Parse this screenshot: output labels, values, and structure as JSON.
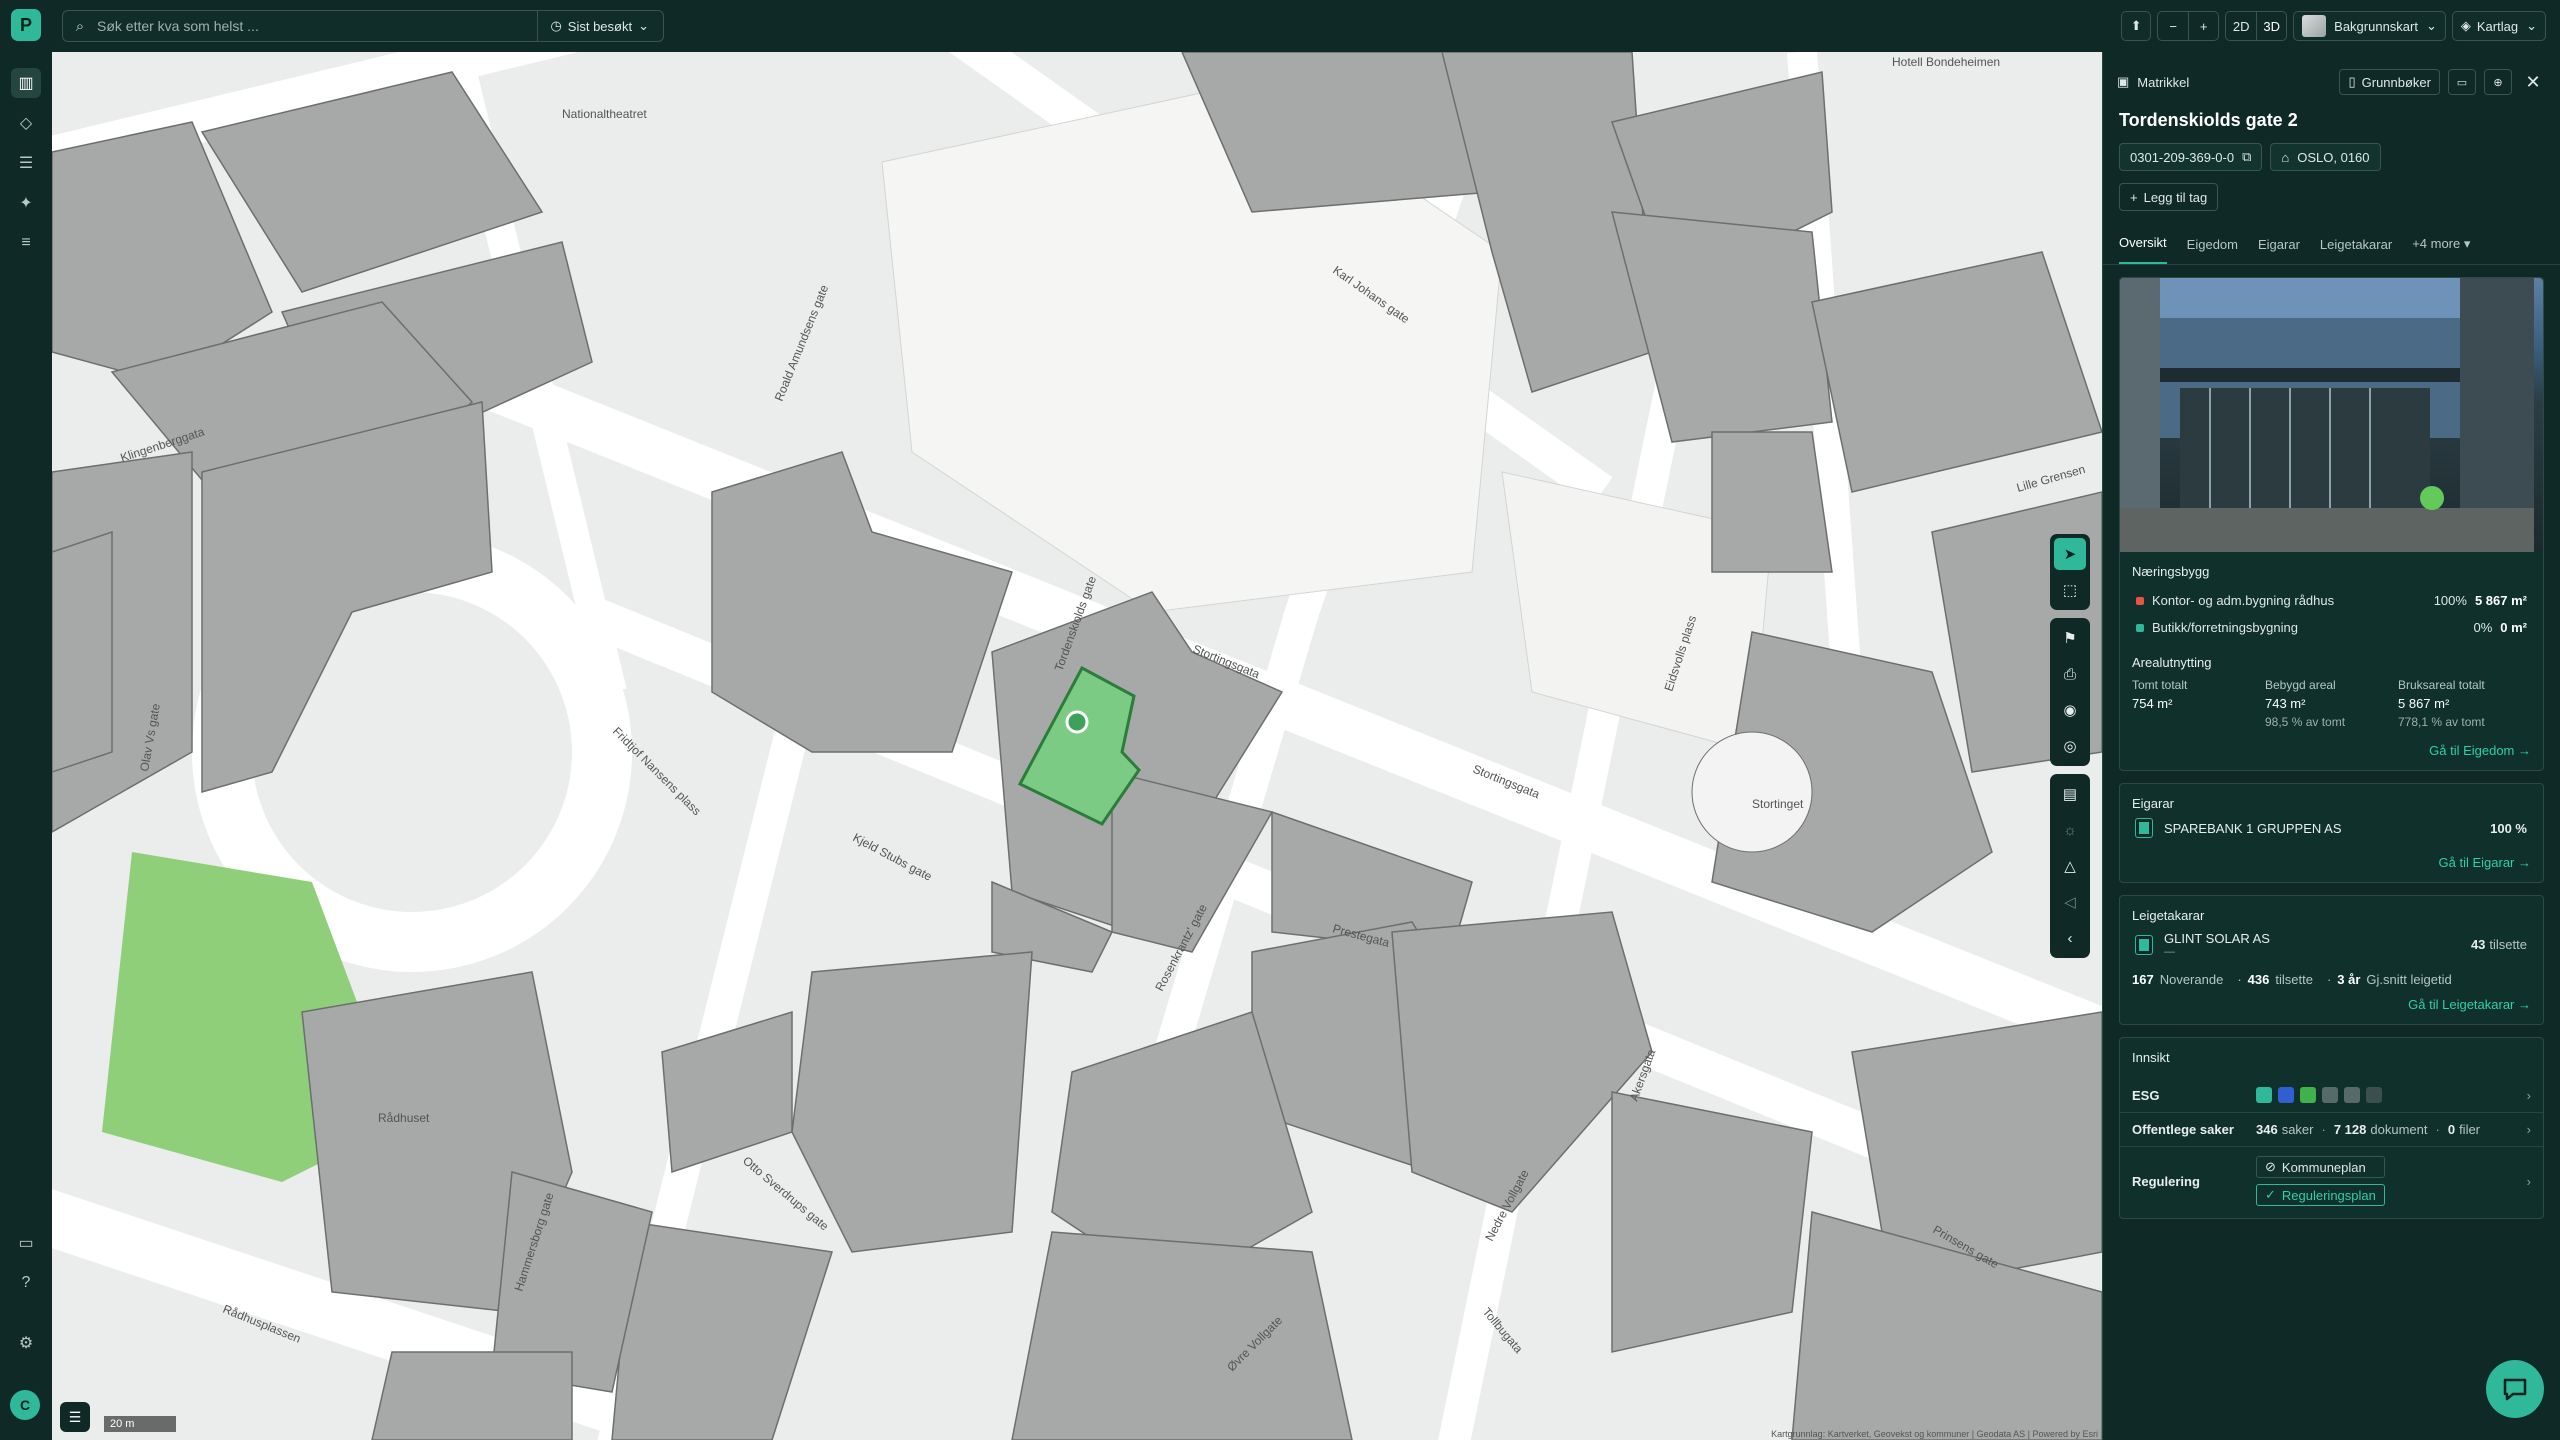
{
  "search": {
    "placeholder": "Søk etter kva som helst ...",
    "recent_label": "Sist besøkt"
  },
  "toolbar": {
    "zoom_out": "−",
    "zoom_in": "+",
    "view_2d": "2D",
    "view_3d": "3D",
    "background_label": "Bakgrunnskart",
    "layers_label": "Kartlag"
  },
  "map": {
    "scale_label": "20 m",
    "attribution": "Kartgrunnlag: Kartverket, Geovekst og kommuner | Geodata AS | Powered by Esri",
    "streets": [
      "Stortingsgata",
      "Karl Johans gate",
      "Roald Amundsens gate",
      "Tordenskiolds gate",
      "Kjeld Stubs gate",
      "Rosenkrantz' gate",
      "Fridtjof Nansens plass",
      "Klingenberggata",
      "Olav Vs gate",
      "Prestegata",
      "Akersgata",
      "Nedre Vollgate",
      "Tollbugata",
      "Rådhusplassen",
      "Hammersborg gate",
      "Otto Sverdrups gate",
      "Øvre Vollgate",
      "Lille Grensen",
      "Eidsvolls plass",
      "Prinsens gate"
    ],
    "places": [
      "Nationaltheatret",
      "Rådhuset",
      "Stortinget",
      "Hotell Bondeheimen"
    ]
  },
  "panel": {
    "breadcrumb": "Matrikkel",
    "grunnboker_label": "Grunnbøker",
    "title": "Tordenskiolds gate 2",
    "matrikkel_id": "0301-209-369-0-0",
    "location": "OSLO, 0160",
    "add_tag": "Legg til tag",
    "tabs": [
      "Oversikt",
      "Eigedom",
      "Eigarar",
      "Leigetakarar",
      "+4 more"
    ],
    "building_type": "Næringsbygg",
    "uses": [
      {
        "name": "Kontor- og adm.bygning rådhus",
        "pct": "100%",
        "area": "5 867 m²",
        "color": "#e8543f"
      },
      {
        "name": "Butikk/forretningsbygning",
        "pct": "0%",
        "area": "0 m²",
        "color": "#2fb89a"
      }
    ],
    "area_title": "Arealutnytting",
    "area_stats": [
      {
        "label": "Tomt totalt",
        "value": "754 m²",
        "sub": ""
      },
      {
        "label": "Bebygd areal",
        "value": "743 m²",
        "sub": "98,5 % av tomt"
      },
      {
        "label": "Bruksareal totalt",
        "value": "5 867 m²",
        "sub": "778,1 % av tomt"
      }
    ],
    "to_property": "Gå til Eigedom →",
    "owners_title": "Eigarar",
    "owner_name": "SPAREBANK 1 GRUPPEN AS",
    "owner_pct": "100 %",
    "to_owners": "Gå til Eigarar →",
    "tenants_title": "Leigetakarar",
    "tenant_name": "GLINT SOLAR AS",
    "tenant_sub": "—",
    "tenant_employees": "43",
    "tenant_employees_label": "tilsette",
    "tenant_current": "167",
    "tenant_current_label": "Noverande",
    "tenant_total_emp": "436",
    "tenant_total_emp_label": "tilsette",
    "tenant_avg": "3 år",
    "tenant_avg_label": "Gj.snitt leigetid",
    "to_tenants": "Gå til Leigetakarar →",
    "insight_title": "Innsikt",
    "esg_label": "ESG",
    "public_label": "Offentlege saker",
    "public_cases": "346",
    "public_cases_label": "saker",
    "public_docs": "7 128",
    "public_docs_label": "dokument",
    "public_files": "0",
    "public_files_label": "filer",
    "regulation_label": "Regulering",
    "reg_1": "Kommuneplan",
    "reg_2": "Reguleringsplan"
  },
  "user": {
    "initial": "C"
  },
  "colors": {
    "accent": "#2fb89a",
    "panel_bg": "#0f2a26",
    "selected_lot": "#7ccb84"
  }
}
